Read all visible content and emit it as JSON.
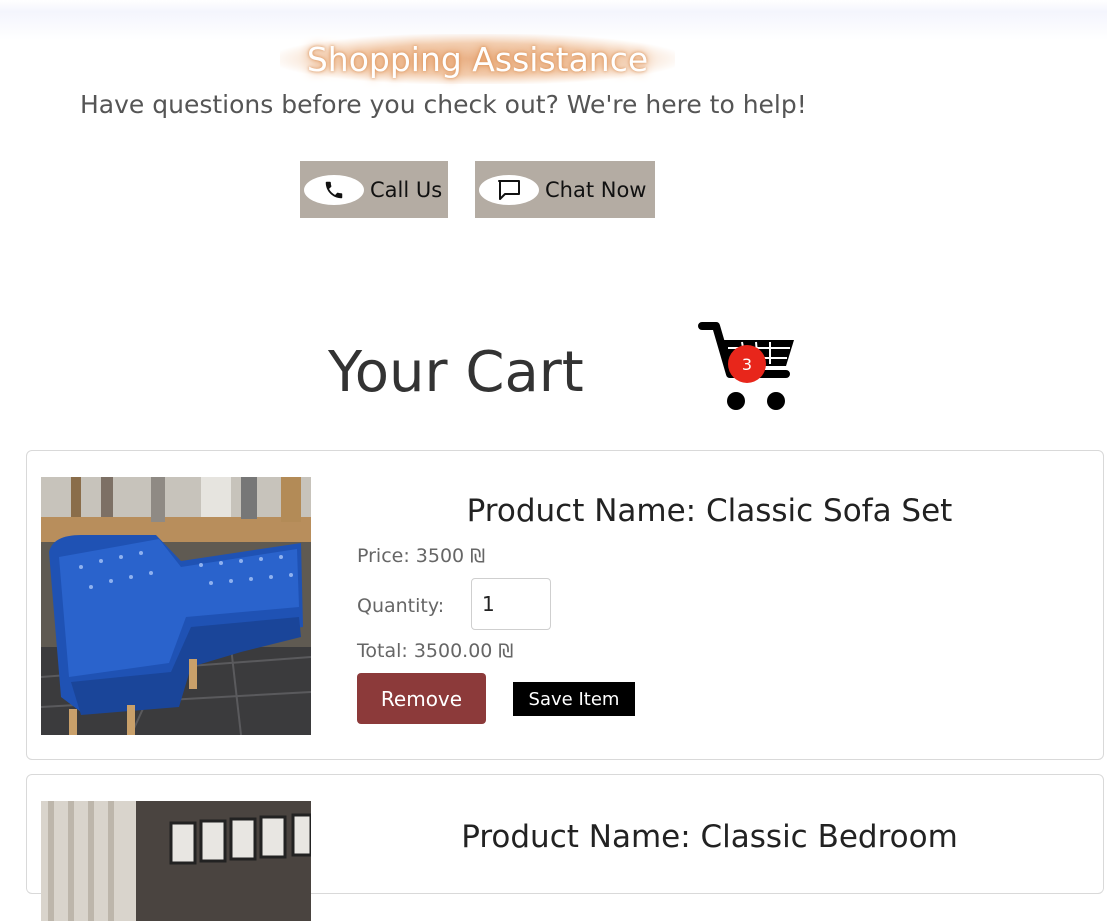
{
  "assistance": {
    "title": "Shopping Assistance",
    "subtitle": "Have questions before you check out? We're here to help!",
    "call_label": "Call Us",
    "chat_label": "Chat Now"
  },
  "cart": {
    "title": "Your Cart",
    "count": "3"
  },
  "items": [
    {
      "name": "Product Name: Classic Sofa Set",
      "price": "Price: 3500 ₪",
      "quantity_label": "Quantity:",
      "quantity": "1",
      "total": "Total: 3500.00 ₪",
      "remove_label": "Remove",
      "save_label": "Save Item",
      "image": "blue tufted corner sofa"
    },
    {
      "name": "Product Name: Classic Bedroom",
      "image": "bedroom with framed pictures"
    }
  ],
  "colors": {
    "remove_button": "#8c3a3a",
    "save_button": "#000000",
    "contact_button": "#b4aca3",
    "badge": "#e8261b"
  }
}
